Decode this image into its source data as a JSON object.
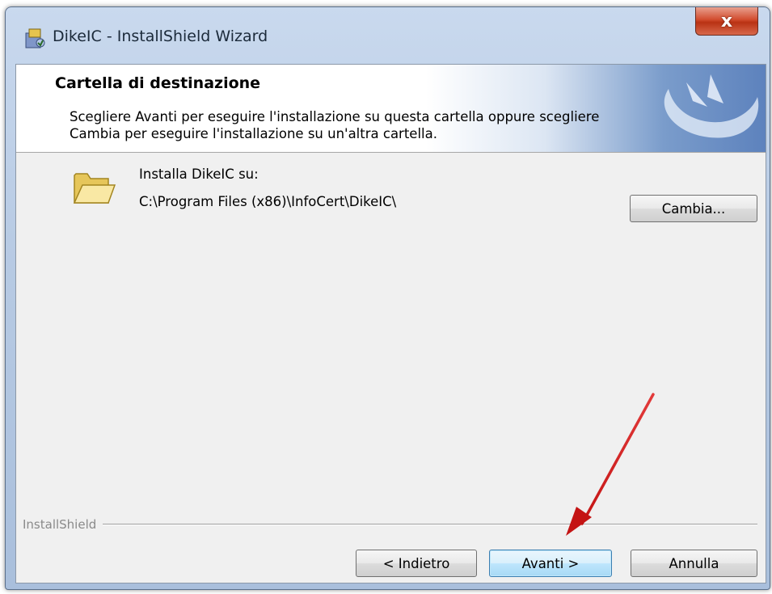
{
  "window": {
    "title": "DikeIC - InstallShield Wizard",
    "close_label": "x"
  },
  "header": {
    "title": "Cartella di destinazione",
    "description": "Scegliere Avanti per eseguire l'installazione su questa cartella oppure scegliere Cambia per eseguire l'installazione su un'altra cartella."
  },
  "destination": {
    "label": "Installa DikeIC su:",
    "path": "C:\\Program Files (x86)\\InfoCert\\DikeIC\\",
    "change_label": "Cambia..."
  },
  "footer": {
    "brand": "InstallShield",
    "back_label": "< Indietro",
    "next_label": "Avanti >",
    "cancel_label": "Annulla"
  },
  "colors": {
    "accent_arrow": "#d42020",
    "header_blue": "#5d82bd",
    "default_button_border": "#3c7fb1"
  },
  "icons": [
    "installer-app-icon",
    "folder-icon",
    "installshield-logo",
    "close-icon",
    "annotation-arrow"
  ]
}
